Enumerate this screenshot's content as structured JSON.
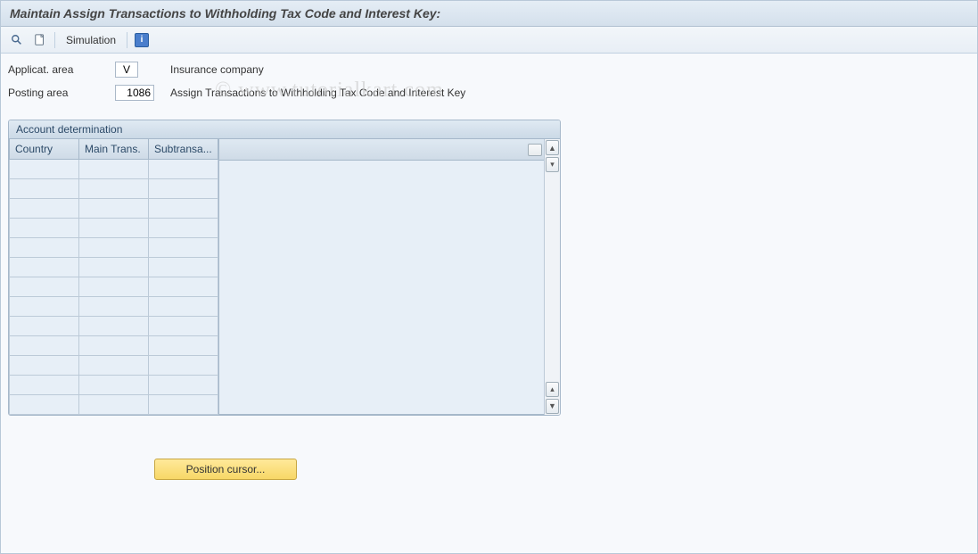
{
  "title": "Maintain Assign Transactions to Withholding Tax Code and Interest Key:",
  "toolbar": {
    "simulation_label": "Simulation"
  },
  "form": {
    "applicat_area": {
      "label": "Applicat. area",
      "value": "V",
      "desc": "Insurance company"
    },
    "posting_area": {
      "label": "Posting area",
      "value": "1086",
      "desc": "Assign Transactions to Withholding Tax Code and Interest Key"
    }
  },
  "section": {
    "title": "Account determination",
    "columns": [
      "Country",
      "Main Trans.",
      "Subtransa..."
    ],
    "row_count": 13
  },
  "position_button_label": "Position cursor...",
  "watermark": "© www.tutorialkart.com"
}
